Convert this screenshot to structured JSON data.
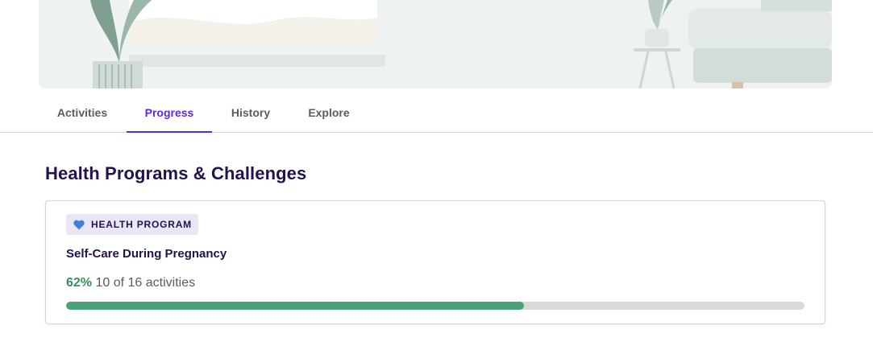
{
  "tabs": [
    {
      "label": "Activities",
      "active": false
    },
    {
      "label": "Progress",
      "active": true
    },
    {
      "label": "History",
      "active": false
    },
    {
      "label": "Explore",
      "active": false
    }
  ],
  "section": {
    "title": "Health Programs & Challenges"
  },
  "program_card": {
    "badge_icon": "heart-icon",
    "badge_label": "HEALTH PROGRAM",
    "title": "Self-Care During Pregnancy",
    "progress_percent_label": "62%",
    "progress_detail": "10 of 16 activities",
    "progress_fraction": 0.62
  },
  "colors": {
    "accent": "#5a2bd6",
    "heading": "#24124d",
    "progress_green": "#49a37a",
    "badge_bg": "#e9e6f6",
    "heart_blue": "#3b82d6"
  }
}
